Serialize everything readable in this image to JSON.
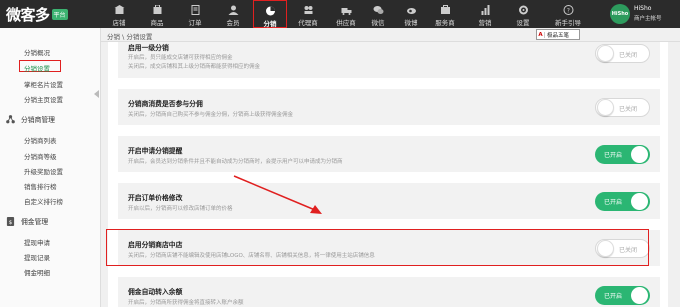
{
  "brand": {
    "name": "微客多",
    "badge": "平台"
  },
  "nav": [
    {
      "label": "店铺",
      "icon": "store-icon"
    },
    {
      "label": "商品",
      "icon": "goods-icon"
    },
    {
      "label": "订单",
      "icon": "order-icon"
    },
    {
      "label": "会员",
      "icon": "member-icon"
    },
    {
      "label": "分销",
      "icon": "distribution-icon",
      "active": true
    },
    {
      "label": "代理商",
      "icon": "agent-icon"
    },
    {
      "label": "供应商",
      "icon": "supplier-icon"
    },
    {
      "label": "微信",
      "icon": "wechat-icon"
    },
    {
      "label": "微博",
      "icon": "weibo-icon"
    },
    {
      "label": "服务商",
      "icon": "service-icon"
    },
    {
      "label": "营销",
      "icon": "marketing-icon"
    },
    {
      "label": "设置",
      "icon": "settings-icon"
    },
    {
      "label": "新手引导",
      "icon": "guide-icon"
    }
  ],
  "user": {
    "avatar_text": "HiSho",
    "name": "HiSho",
    "role": "商户主帐号"
  },
  "ime": {
    "glyph": "A",
    "text": "极品五笔"
  },
  "sidebar": {
    "group1_items": [
      "分销概况",
      "分销设置",
      "掌柜名片设置",
      "分销主页设置"
    ],
    "group2_title": "分销商管理",
    "group2_items": [
      "分销商列表",
      "分销商等级",
      "升级奖励设置",
      "销售排行榜",
      "自定义排行榜"
    ],
    "group3_title": "佣金管理",
    "group3_items": [
      "提现申请",
      "提现记录",
      "佣金明细"
    ]
  },
  "breadcrumb": "分销 \\ 分销设置",
  "settings": [
    {
      "title": "启用一级分销",
      "desc": "开启后，员只能成交店铺可获得相应的佣金\n关闭后，成交店铺和其上级分销商都能获得相应的佣金",
      "toggle": "已关闭",
      "on": false
    },
    {
      "title": "分销商消费是否参与分佣",
      "desc": "关闭后，分销商自己购买不参与佣金分佣，分销商上级获得佣金佣金",
      "toggle": "已关闭",
      "on": false
    },
    {
      "title": "开启申请分销提醒",
      "desc": "开启后，会员达到分销条件并且不能自动成为分销商时，会提示用户可以申请成为分销商",
      "toggle": "已开启",
      "on": true
    },
    {
      "title": "开启订单价格修改",
      "desc": "开启以后，分销商可以修改店铺订单的价格",
      "toggle": "已开启",
      "on": true
    },
    {
      "title": "启用分销商店中店",
      "desc": "关闭后，分销商店铺不能编辑及使用店铺LOGO、店铺名称、店铺相关信息，将一律使用主站店铺信息",
      "toggle": "已关闭",
      "on": false
    },
    {
      "title": "佣金自动转入余额",
      "desc": "开启后，分销商所获得佣金将直接转入账户余额",
      "toggle": "已开启",
      "on": true
    }
  ],
  "colors": {
    "accent": "#2bb673",
    "highlight": "#e02020",
    "topbar": "#2b2b2b"
  }
}
